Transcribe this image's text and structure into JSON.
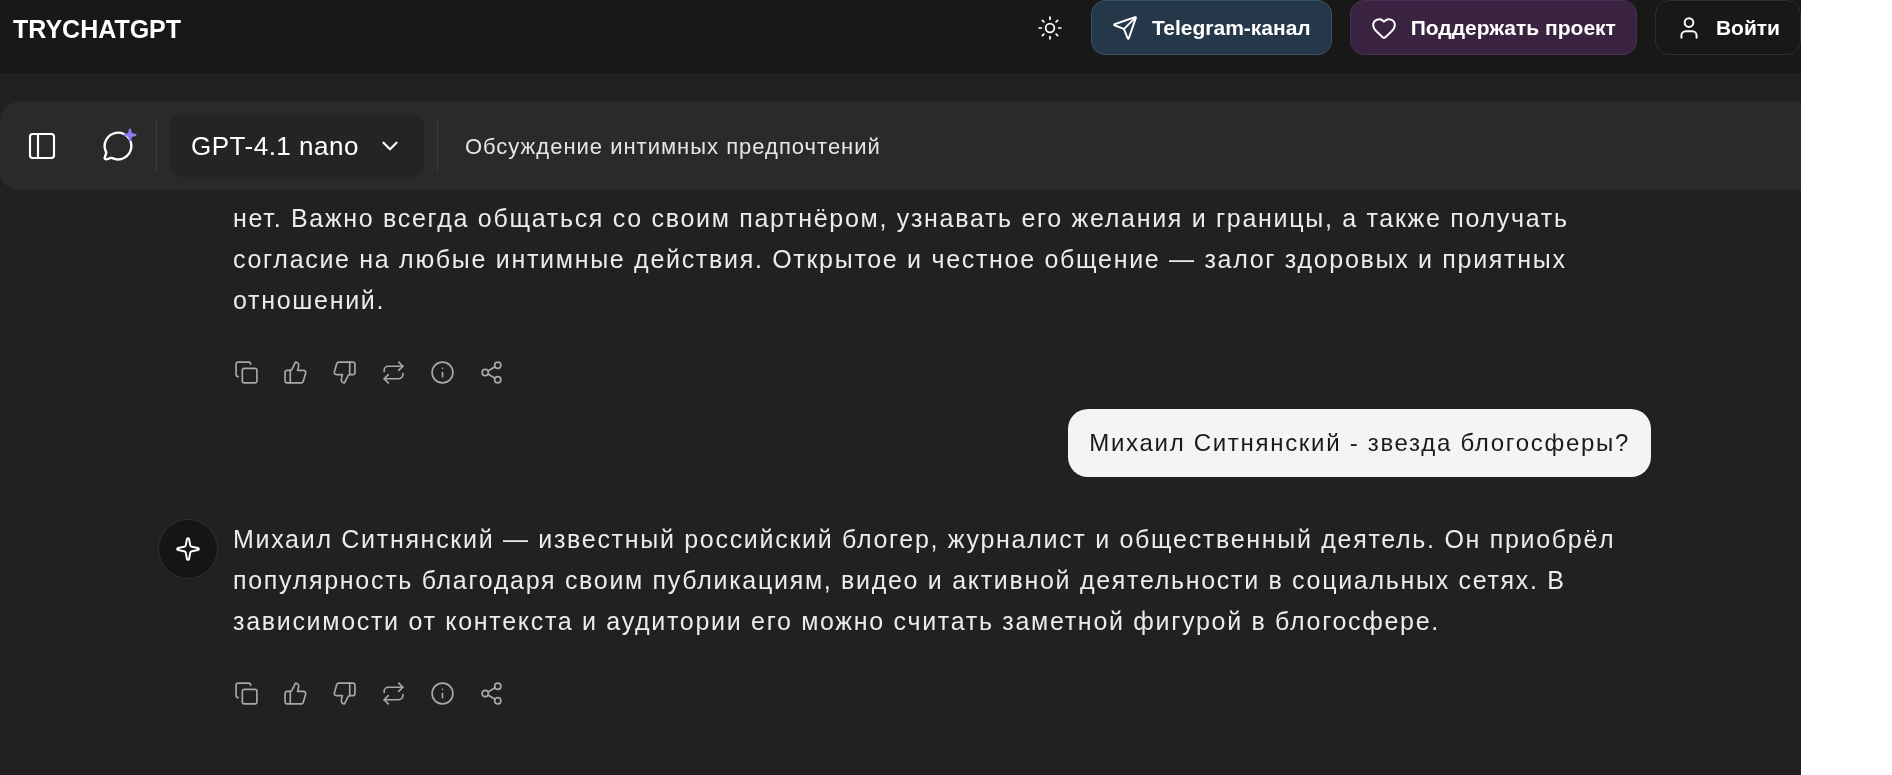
{
  "header": {
    "logo": "TRYCHATGPT",
    "buttons": [
      {
        "kind": "telegram",
        "label": "Telegram-канал"
      },
      {
        "kind": "support",
        "label": "Поддержать проект"
      },
      {
        "kind": "login",
        "label": "Войти"
      }
    ]
  },
  "toolbar": {
    "model": "GPT-4.1 nano",
    "chat_title": "Обсуждение интимных предпочтений"
  },
  "messages": [
    {
      "kind": "assistant",
      "text": "нет. Важно всегда общаться со своим партнёром, узнавать его желания и границы, а также получать согласие на любые интимные действия. Открытое и честное общение — залог здоровых и приятных отношений."
    },
    {
      "kind": "user",
      "text": "Михаил Ситнянский - звезда блогосферы?"
    },
    {
      "kind": "assistant",
      "avatar": true,
      "text": "Михаил Ситнянский — известный российский блогер, журналист и общественный деятель. Он приобрёл популярность благодаря своим публикациям, видео и активной деятельности в социальных сетях. В зависимости от контекста и аудитории его можно считать заметной фигурой в блогосфере."
    }
  ]
}
